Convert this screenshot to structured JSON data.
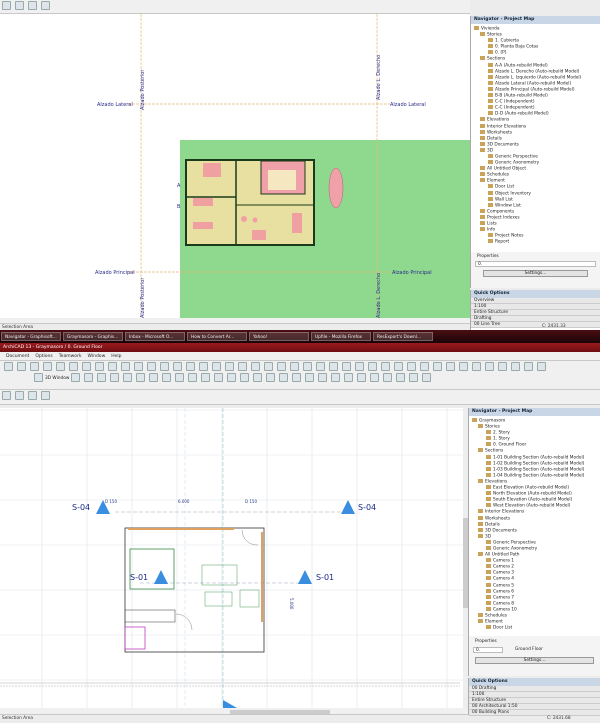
{
  "top_window": {
    "canvas_labels": {
      "left_upper": "Alzado Lateral",
      "right_upper": "Alzado Lateral",
      "left_lower": "Alzado Principal",
      "right_lower": "Alzado Principal",
      "vert_left_top": "Alzado Posterior",
      "vert_right_top": "Alzado L. Derecho",
      "vert_left_bottom": "Alzado Posterior",
      "vert_right_bottom": "Alzado L. Derecho",
      "marker_a": "A",
      "marker_b": "B"
    },
    "navigator": {
      "title": "Navigator - Project Map",
      "tree": [
        "Vivienda",
        "Stories",
        "1. Cubierta",
        "0. Planta Baja Cotas",
        "0. [P]",
        "Sections",
        "A-A (Auto-rebuild Model)",
        "Alzado L. Derecho (Auto-rebuild Model)",
        "Alzado L. Izquierdo (Auto-rebuild Model)",
        "Alzado Lateral (Auto-rebuild Model)",
        "Alzado Principal (Auto-rebuild Model)",
        "B-B (Auto-rebuild Model)",
        "C-C (Independent)",
        "C-C (Independent)",
        "D-D (Auto-rebuild Model)",
        "Elevations",
        "Interior Elevations",
        "Worksheets",
        "Details",
        "3D Documents",
        "3D",
        "Generic Perspective",
        "Generic Axonometry",
        "All Untitled Object",
        "Schedules",
        "Element",
        "Door List",
        "Object Inventory",
        "Wall List",
        "Window List",
        "Components",
        "Project Indexes",
        "Lists",
        "Info",
        "Project Notes",
        "Report"
      ]
    },
    "properties": {
      "label": "Properties",
      "field": "0.",
      "settings": "Settings..."
    },
    "quick_options": {
      "title": "Quick Options",
      "rows": [
        "Overview",
        "1:100",
        "Entire Structure",
        "Drafting",
        "00 Line Tree"
      ]
    },
    "status": {
      "left": "Selection Area",
      "right": "C: 2431.33"
    }
  },
  "taskbar": {
    "items": [
      "Navigator - Graphisoft...",
      "Graymasoro - Graphis...",
      "Inbox - Microsoft O...",
      "How to Convert Ar...",
      "Yahoo!",
      "Upfile - Mozilla Firefox",
      "ResExport's Downl..."
    ]
  },
  "bottom_window": {
    "title": "ArchiCAD 13 - Graymasoro / 0. Ground Floor",
    "menu": [
      "Document",
      "Options",
      "Teamwork",
      "Window",
      "Help"
    ],
    "view_button": "3D Window",
    "canvas_labels": {
      "s04_left": "S-04",
      "s04_right": "S-04",
      "s01_left": "S-01",
      "s01_right": "S-01",
      "dim_left": "D 150",
      "dim_mid": "6.000",
      "dim_right": "D 150",
      "dim_vertical": "5.000"
    },
    "navigator": {
      "title": "Navigator - Project Map",
      "tree": [
        "Graymasoro",
        "Stories",
        "2. Story",
        "1. Story",
        "0. Ground Floor",
        "Sections",
        "1-01 Building Section (Auto-rebuild Model)",
        "1-02 Building Section (Auto-rebuild Model)",
        "1-03 Building Section (Auto-rebuild Model)",
        "1-04 Building Section (Auto-rebuild Model)",
        "Elevations",
        "East Elevation (Auto-rebuild Model)",
        "North Elevation (Auto-rebuild Model)",
        "South Elevation (Auto-rebuild Model)",
        "West Elevation (Auto-rebuild Model)",
        "Interior Elevations",
        "Worksheets",
        "Details",
        "3D Documents",
        "3D",
        "Generic Perspective",
        "Generic Axonometry",
        "All Untitled Path",
        "Camera 1",
        "Camera 2",
        "Camera 3",
        "Camera 4",
        "Camera 5",
        "Camera 6",
        "Camera 7",
        "Camera 8",
        "Camera 10",
        "Schedules",
        "Element",
        "Door List"
      ]
    },
    "properties": {
      "label": "Properties",
      "field": "0.",
      "value": "Ground Floor",
      "settings": "Settings..."
    },
    "quick_options": {
      "title": "Quick Options",
      "rows": [
        "00 Drafting",
        "1:100",
        "Entire Structure",
        "00 Architectural 1:50",
        "00 Building Plans"
      ]
    },
    "status": {
      "left": "Selection Area",
      "right": "C: 2431.68"
    }
  }
}
